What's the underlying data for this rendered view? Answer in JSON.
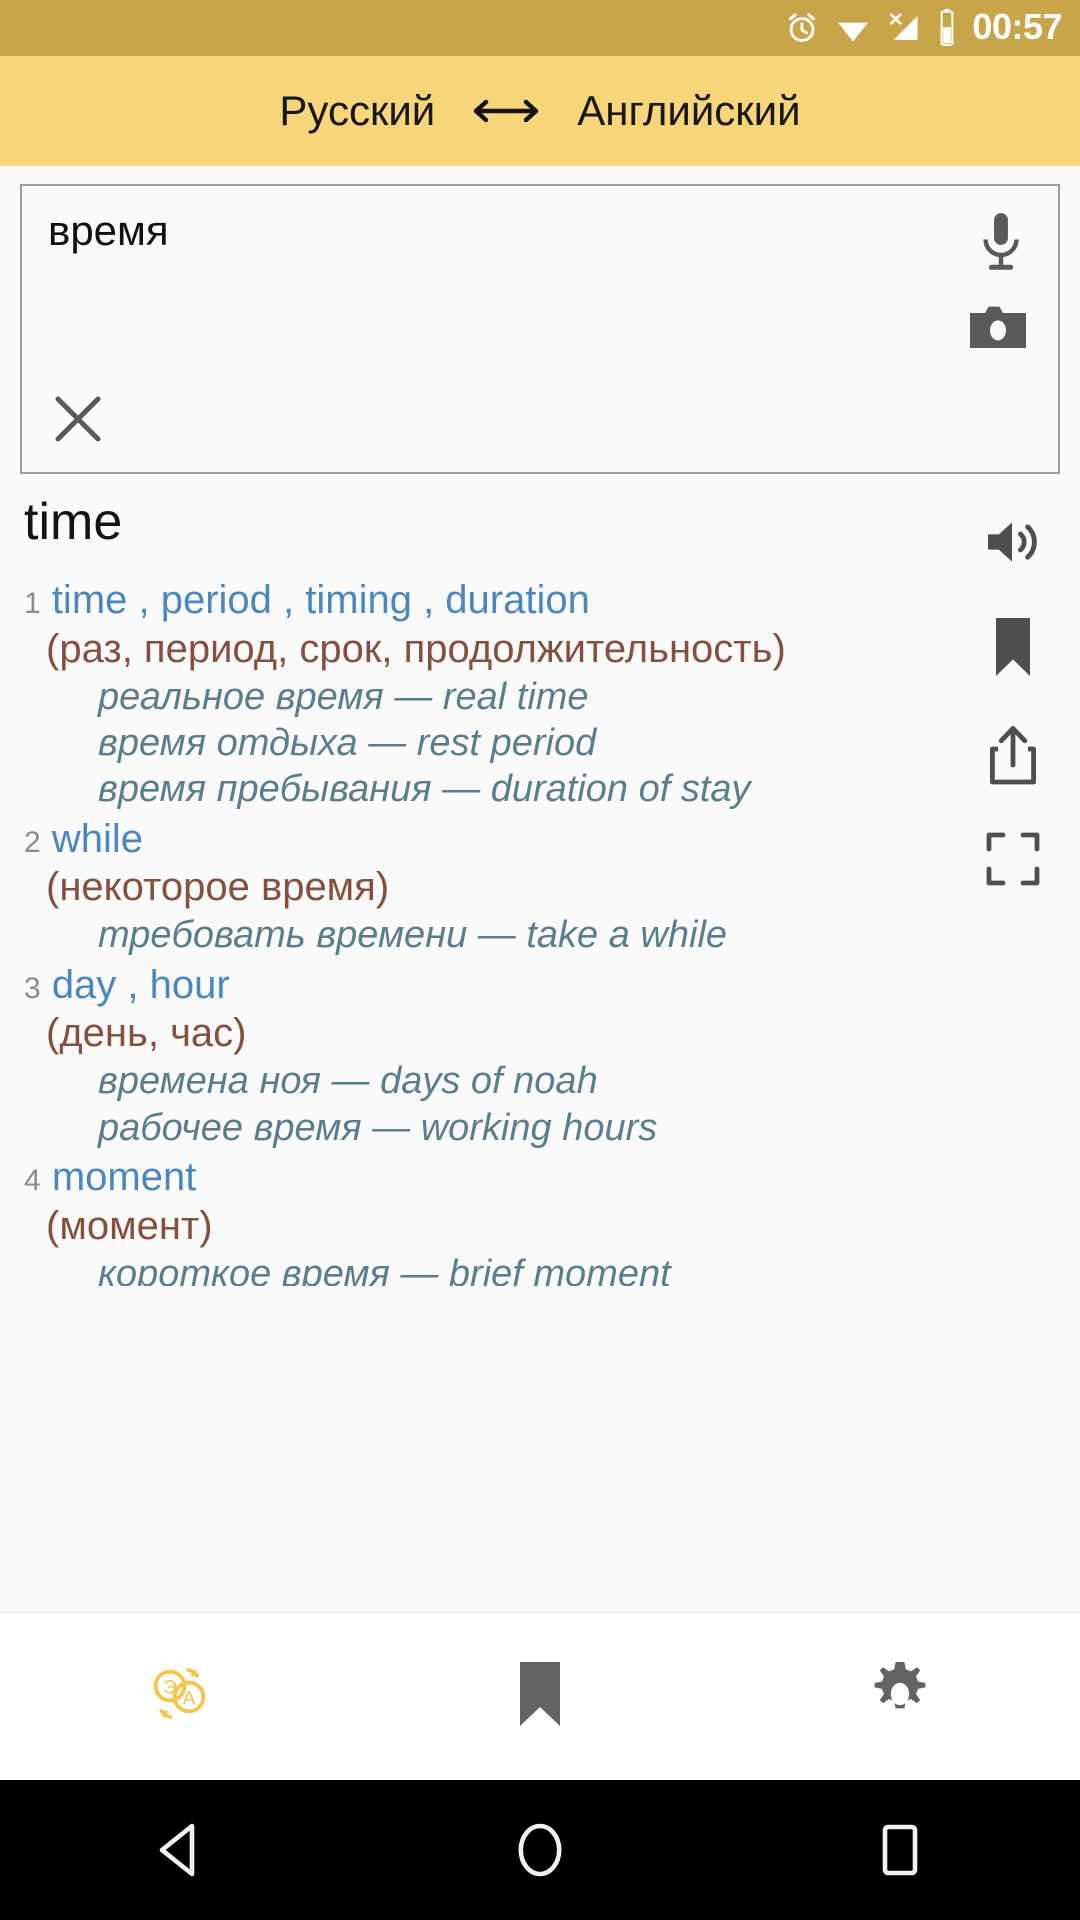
{
  "status_bar": {
    "time": "00:57",
    "background": "#C9A549",
    "icons": [
      "alarm-icon",
      "wifi-icon",
      "signal-off-icon",
      "battery-icon"
    ]
  },
  "header": {
    "source_language": "Русский",
    "swap_icon": "swap-horizontal-icon",
    "target_language": "Английский",
    "background": "#F7D679"
  },
  "search": {
    "value": "время",
    "placeholder": "",
    "mic_icon": "microphone-icon",
    "camera_icon": "camera-icon",
    "clear_icon": "close-icon"
  },
  "result": {
    "headword": "time",
    "entries": [
      {
        "num": "1",
        "synonyms": "time , period , timing , duration",
        "gloss": "(раз, период, срок, продолжительность)",
        "examples": [
          "реальное время — real time",
          "время отдыха — rest period",
          "время пребывания — duration of stay"
        ]
      },
      {
        "num": "2",
        "synonyms": "while",
        "gloss": "(некоторое время)",
        "examples": [
          "требовать времени — take a while"
        ]
      },
      {
        "num": "3",
        "synonyms": "day , hour",
        "gloss": "(день, час)",
        "examples": [
          "времена ноя — days of noah",
          "рабочее время — working hours"
        ]
      },
      {
        "num": "4",
        "synonyms": "moment",
        "gloss": "(момент)",
        "examples": [
          "короткое время — brief moment"
        ]
      }
    ]
  },
  "action_rail": {
    "items": [
      {
        "icon": "speaker-icon",
        "label": "Произнести"
      },
      {
        "icon": "bookmark-icon",
        "label": "В закладки"
      },
      {
        "icon": "share-icon",
        "label": "Поделиться"
      },
      {
        "icon": "fullscreen-icon",
        "label": "Во весь экран"
      }
    ]
  },
  "tab_bar": {
    "tabs": [
      {
        "icon": "translate-icon",
        "label": "Перевод",
        "active": true
      },
      {
        "icon": "bookmark-icon",
        "label": "Закладки",
        "active": false
      },
      {
        "icon": "gear-icon",
        "label": "Настройки",
        "active": false
      }
    ],
    "active_color": "#F7C445",
    "inactive_color": "#636363"
  },
  "nav_bar": {
    "buttons": [
      {
        "icon": "back-triangle-icon",
        "label": "Назад"
      },
      {
        "icon": "home-circle-icon",
        "label": "Домой"
      },
      {
        "icon": "recents-square-icon",
        "label": "Обзор"
      }
    ]
  },
  "colors": {
    "status_bg": "#C9A549",
    "header_bg": "#F7D679",
    "synonym_blue": "#4B87BE",
    "gloss_brown": "#86503F",
    "example_teal": "#5B7E8C",
    "page_bg": "#FAFAFA"
  }
}
